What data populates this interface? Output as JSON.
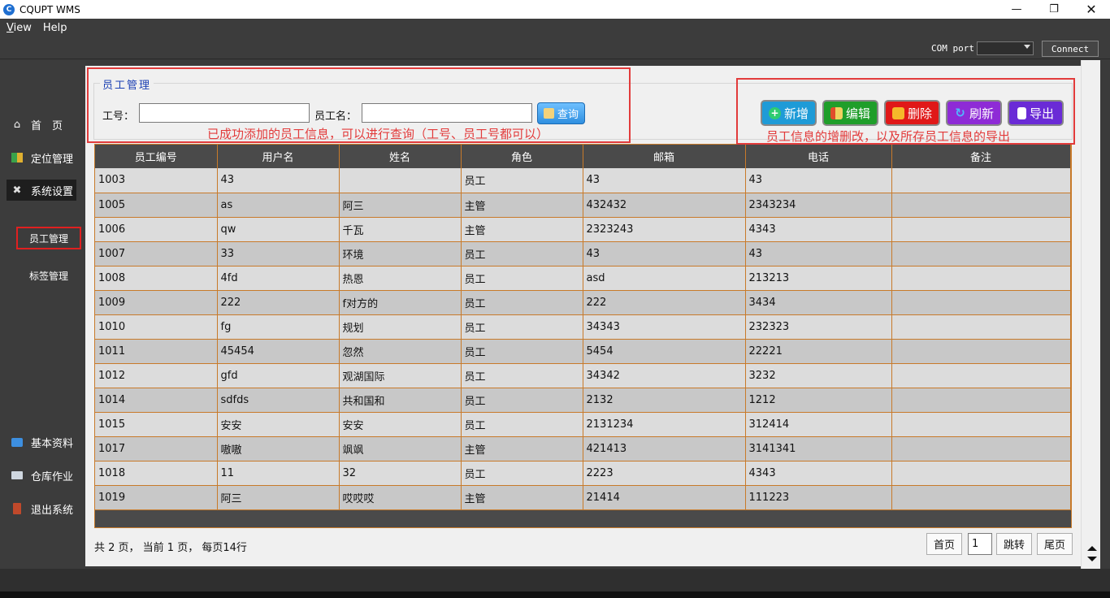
{
  "window": {
    "title": "CQUPT WMS",
    "icon": "app-icon",
    "controls": [
      "minimize",
      "maximize",
      "close"
    ]
  },
  "menu": [
    {
      "label": "View",
      "hotkey": "V",
      "rest": "iew"
    },
    {
      "label": "Help",
      "hotkey": "",
      "rest": "Help"
    }
  ],
  "toolbar": {
    "com_label": "COM port",
    "com_value": "",
    "connect_label": "Connect"
  },
  "sidebar": {
    "items": [
      {
        "label": "首　页",
        "icon": "home-icon"
      },
      {
        "label": "定位管理",
        "icon": "map-icon"
      },
      {
        "label": "系统设置",
        "icon": "tools-icon",
        "active": true
      },
      {
        "label": "基本资料",
        "icon": "folder-icon"
      },
      {
        "label": "仓库作业",
        "icon": "warehouse-icon"
      },
      {
        "label": "退出系统",
        "icon": "exit-icon"
      }
    ],
    "subitems": [
      {
        "label": "员工管理",
        "selected": true
      },
      {
        "label": "标签管理",
        "selected": false
      }
    ]
  },
  "search": {
    "group_title": "员工管理",
    "id_label": "工号：",
    "id_value": "",
    "name_label": "员工名：",
    "name_value": "",
    "query_button": "查询"
  },
  "actions": {
    "add": "新增",
    "edit": "编辑",
    "delete": "删除",
    "refresh": "刷新",
    "export": "导出"
  },
  "annotations": {
    "left": "已成功添加的员工信息，可以进行查询（工号、员工号都可以）",
    "right": "员工信息的增删改，以及所存员工信息的导出"
  },
  "table": {
    "columns": [
      "员工编号",
      "用户名",
      "姓名",
      "角色",
      "邮箱",
      "电话",
      "备注"
    ],
    "rows": [
      [
        "1003",
        "43",
        "",
        "员工",
        "43",
        "43",
        ""
      ],
      [
        "1005",
        "as",
        "阿三",
        "主管",
        "432432",
        "2343234",
        ""
      ],
      [
        "1006",
        "qw",
        "千瓦",
        "主管",
        "2323243",
        "4343",
        ""
      ],
      [
        "1007",
        "33",
        "环境",
        "员工",
        "43",
        "43",
        ""
      ],
      [
        "1008",
        "4fd",
        "热恩",
        "员工",
        "asd",
        "213213",
        ""
      ],
      [
        "1009",
        "222",
        "f对方的",
        "员工",
        "222",
        "3434",
        ""
      ],
      [
        "1010",
        "fg",
        "规划",
        "员工",
        "34343",
        "232323",
        ""
      ],
      [
        "1011",
        "45454",
        "忽然",
        "员工",
        "5454",
        "22221",
        ""
      ],
      [
        "1012",
        "gfd",
        "观湖国际",
        "员工",
        "34342",
        "3232",
        ""
      ],
      [
        "1014",
        "sdfds",
        "共和国和",
        "员工",
        "2132",
        "1212",
        ""
      ],
      [
        "1015",
        "安安",
        "安安",
        "员工",
        "2131234",
        "312414",
        ""
      ],
      [
        "1017",
        "嗷嗷",
        "飒飒",
        "主管",
        "421413",
        "3141341",
        ""
      ],
      [
        "1018",
        "11",
        "32",
        "员工",
        "2223",
        "4343",
        ""
      ],
      [
        "1019",
        "阿三",
        "哎哎哎",
        "主管",
        "21414",
        "111223",
        ""
      ]
    ]
  },
  "pager": {
    "info": "共 2 页， 当前 1 页， 每页14行",
    "first": "首页",
    "page_value": "1",
    "jump": "跳转",
    "last": "尾页"
  },
  "colors": {
    "annotation_red": "#e23b3b",
    "grid_border": "#c87a2a",
    "add_button": "#1e9bd7",
    "edit_button": "#1f9e2a",
    "delete_button": "#e01818",
    "refresh_button": "#8e2bd6",
    "export_button": "#6a2bd6"
  }
}
